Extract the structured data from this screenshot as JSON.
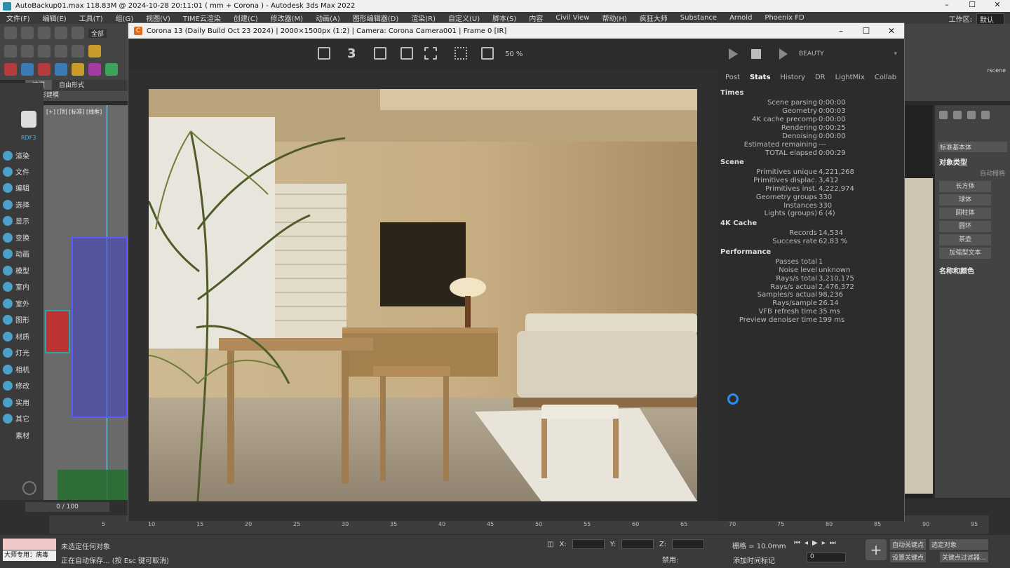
{
  "window": {
    "title": "AutoBackup01.max  118.83M @ 2024-10-28 20:11:01  ( mm + Corona ) - Autodesk 3ds Max 2022",
    "controls": [
      "–",
      "☐",
      "✕"
    ]
  },
  "menubar": {
    "items": [
      "文件(F)",
      "编辑(E)",
      "工具(T)",
      "组(G)",
      "视图(V)",
      "TIME云渲染",
      "创建(C)",
      "修改器(M)",
      "动画(A)",
      "图形编辑器(D)",
      "渲染(R)",
      "自定义(U)",
      "脚本(S)",
      "内容",
      "Civil View",
      "帮助(H)",
      "疯狂大师",
      "Substance",
      "Arnold",
      "Phoenix FD"
    ],
    "workspace_label": "工作区:",
    "workspace_value": "默认"
  },
  "left_toolbar": {
    "selection_filter": "全部",
    "ribbon_tabs": [
      "建模",
      "自由形式"
    ],
    "ribbon_sub": "多边形建模"
  },
  "sidebar": {
    "plugin_label": "RDF3",
    "items": [
      "渲染",
      "文件",
      "编辑",
      "选择",
      "显示",
      "变换",
      "动画",
      "模型",
      "室内",
      "室外",
      "图形",
      "材质",
      "灯光",
      "相机",
      "修改",
      "实用",
      "其它",
      "素材"
    ]
  },
  "viewport_left": {
    "label": "[+] [顶] [标准] [线框]"
  },
  "vfb": {
    "title": "Corona 13 (Daily Build Oct 23 2024) | 2000×1500px (1:2) | Camera: Corona Camera001 | Frame 0 [IR]",
    "icon_letter": "C",
    "zoom": "50 %",
    "channel": "BEAUTY",
    "toolbar_number": "3",
    "tabs": [
      "Post",
      "Stats",
      "History",
      "DR",
      "LightMix",
      "Collab"
    ],
    "active_tab": "Stats"
  },
  "stats": {
    "sections": [
      {
        "title": "Times",
        "rows": [
          {
            "k": "Scene parsing",
            "v": "0:00:00"
          },
          {
            "k": "Geometry",
            "v": "0:00:03"
          },
          {
            "k": "4K cache precomp",
            "v": "0:00:00"
          },
          {
            "k": "Rendering",
            "v": "0:00:25"
          },
          {
            "k": "Denoising",
            "v": "0:00:00"
          },
          {
            "k": "Estimated remaining",
            "v": "---"
          },
          {
            "k": "TOTAL elapsed",
            "v": "0:00:29"
          }
        ]
      },
      {
        "title": "Scene",
        "rows": [
          {
            "k": "Primitives unique",
            "v": "4,221,268"
          },
          {
            "k": "Primitives displac.",
            "v": "3,412"
          },
          {
            "k": "Primitives inst.",
            "v": "4,222,974"
          },
          {
            "k": "Geometry groups",
            "v": "330"
          },
          {
            "k": "Instances",
            "v": "330"
          },
          {
            "k": "Lights (groups)",
            "v": "6 (4)"
          }
        ]
      },
      {
        "title": "4K Cache",
        "rows": [
          {
            "k": "Records",
            "v": "14,534"
          },
          {
            "k": "Success rate",
            "v": "62.83 %"
          }
        ]
      },
      {
        "title": "Performance",
        "rows": [
          {
            "k": "Passes total",
            "v": "1"
          },
          {
            "k": "Noise level",
            "v": "unknown"
          },
          {
            "k": "Rays/s total",
            "v": "3,210,175"
          },
          {
            "k": "Rays/s actual",
            "v": "2,476,372"
          },
          {
            "k": "Samples/s actual",
            "v": "98,236"
          },
          {
            "k": "Rays/sample",
            "v": "26.14"
          },
          {
            "k": "VFB refresh time",
            "v": "35 ms"
          },
          {
            "k": "Preview denoiser time",
            "v": "199 ms"
          }
        ]
      }
    ]
  },
  "command_panel": {
    "category": "标准基本体",
    "object_type_title": "对象类型",
    "autogrid": "自动栅格",
    "buttons": [
      "长方体",
      "球体",
      "圆柱体",
      "圆环",
      "茶壶",
      "加强型文本"
    ],
    "name_color_title": "名称和颜色",
    "scene_label": "rscene"
  },
  "timeline": {
    "frame_counter": "0 / 100",
    "ticks": [
      "5",
      "10",
      "15",
      "20",
      "25",
      "30",
      "35",
      "40",
      "45",
      "50",
      "55",
      "60",
      "65",
      "70",
      "75",
      "80",
      "85",
      "90",
      "95"
    ]
  },
  "statusbar": {
    "master_label": "大师专用：病毒",
    "message_top": "未选定任何对象",
    "message_bottom": "正在自动保存...  (按 Esc 键可取消)",
    "x_label": "X:",
    "y_label": "Y:",
    "z_label": "Z:",
    "grid": "栅格 = 10.0mm",
    "disable": "禁用:",
    "add_time_tag": "添加时间标记",
    "frame_value": "0",
    "auto_key": "自动关键点",
    "set_key": "设置关键点",
    "selected_object": "选定对象",
    "key_filters": "关键点过滤器..."
  }
}
